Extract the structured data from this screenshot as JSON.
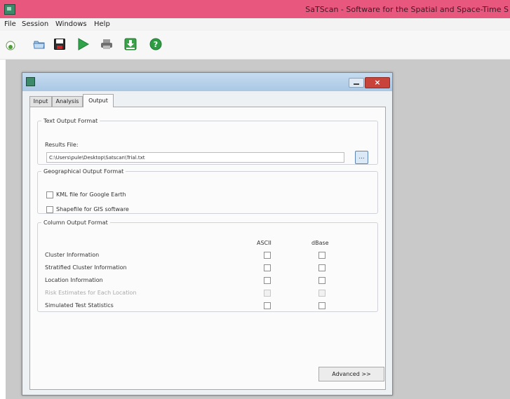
{
  "window": {
    "title": "SaTScan - Software for the Spatial and Space-Time S"
  },
  "menubar": {
    "items": [
      "File",
      "Session",
      "Windows",
      "Help"
    ]
  },
  "toolbar": {
    "icons": [
      "new-session-icon",
      "open-icon",
      "save-icon",
      "run-icon",
      "print-icon",
      "download-icon",
      "help-icon"
    ]
  },
  "dialog": {
    "tabs": [
      "Input",
      "Analysis",
      "Output"
    ],
    "active_tab": "Output",
    "text_output": {
      "legend": "Text Output Format",
      "results_label": "Results File:",
      "results_value": "C:\\Users\\pule\\Desktop\\Satscan\\Trial.txt",
      "browse_label": "..."
    },
    "geo_output": {
      "legend": "Geographical Output Format",
      "options": [
        "KML file for Google Earth",
        "Shapefile for GIS software"
      ]
    },
    "column_output": {
      "legend": "Column Output Format",
      "col_ascii": "ASCII",
      "col_dbase": "dBase",
      "rows": [
        "Cluster Information",
        "Stratified Cluster Information",
        "Location Information",
        "Risk Estimates for Each Location",
        "Simulated Test Statistics"
      ]
    },
    "advanced_label": "Advanced >>"
  },
  "colors": {
    "titlebar": "#e8577e",
    "workspace": "#c9c9c9",
    "dialog_title": "#b5d0ea",
    "close": "#c8433a"
  }
}
